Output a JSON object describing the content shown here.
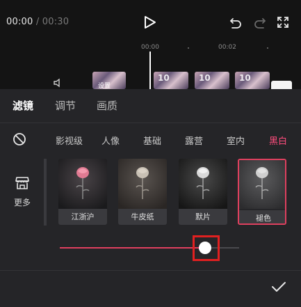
{
  "player": {
    "current_time": "00:00",
    "separator": "/",
    "total_time": "00:30"
  },
  "timeline": {
    "ruler_labels": [
      "00:00",
      "00:02"
    ],
    "clip_digit": "10",
    "clip_text": "设置"
  },
  "tabs": [
    {
      "label": "滤镜",
      "active": true
    },
    {
      "label": "调节",
      "active": false
    },
    {
      "label": "画质",
      "active": false
    }
  ],
  "categories": [
    {
      "label": "影视级",
      "active": false
    },
    {
      "label": "人像",
      "active": false
    },
    {
      "label": "基础",
      "active": false
    },
    {
      "label": "露营",
      "active": false
    },
    {
      "label": "室内",
      "active": false
    },
    {
      "label": "黑白",
      "active": true
    }
  ],
  "store": {
    "label": "更多"
  },
  "filters": [
    {
      "label": "江浙沪",
      "selected": false
    },
    {
      "label": "牛皮纸",
      "selected": false
    },
    {
      "label": "默片",
      "selected": false
    },
    {
      "label": "褪色",
      "selected": true
    }
  ],
  "slider": {
    "value": 0.81
  },
  "colors": {
    "accent": "#e0405f",
    "category_active": "#ff4d7d",
    "highlight": "#e02020"
  },
  "icons": [
    "play-icon",
    "undo-icon",
    "redo-icon",
    "fullscreen-icon",
    "audio-icon",
    "no-filter-icon",
    "store-icon",
    "check-icon"
  ]
}
